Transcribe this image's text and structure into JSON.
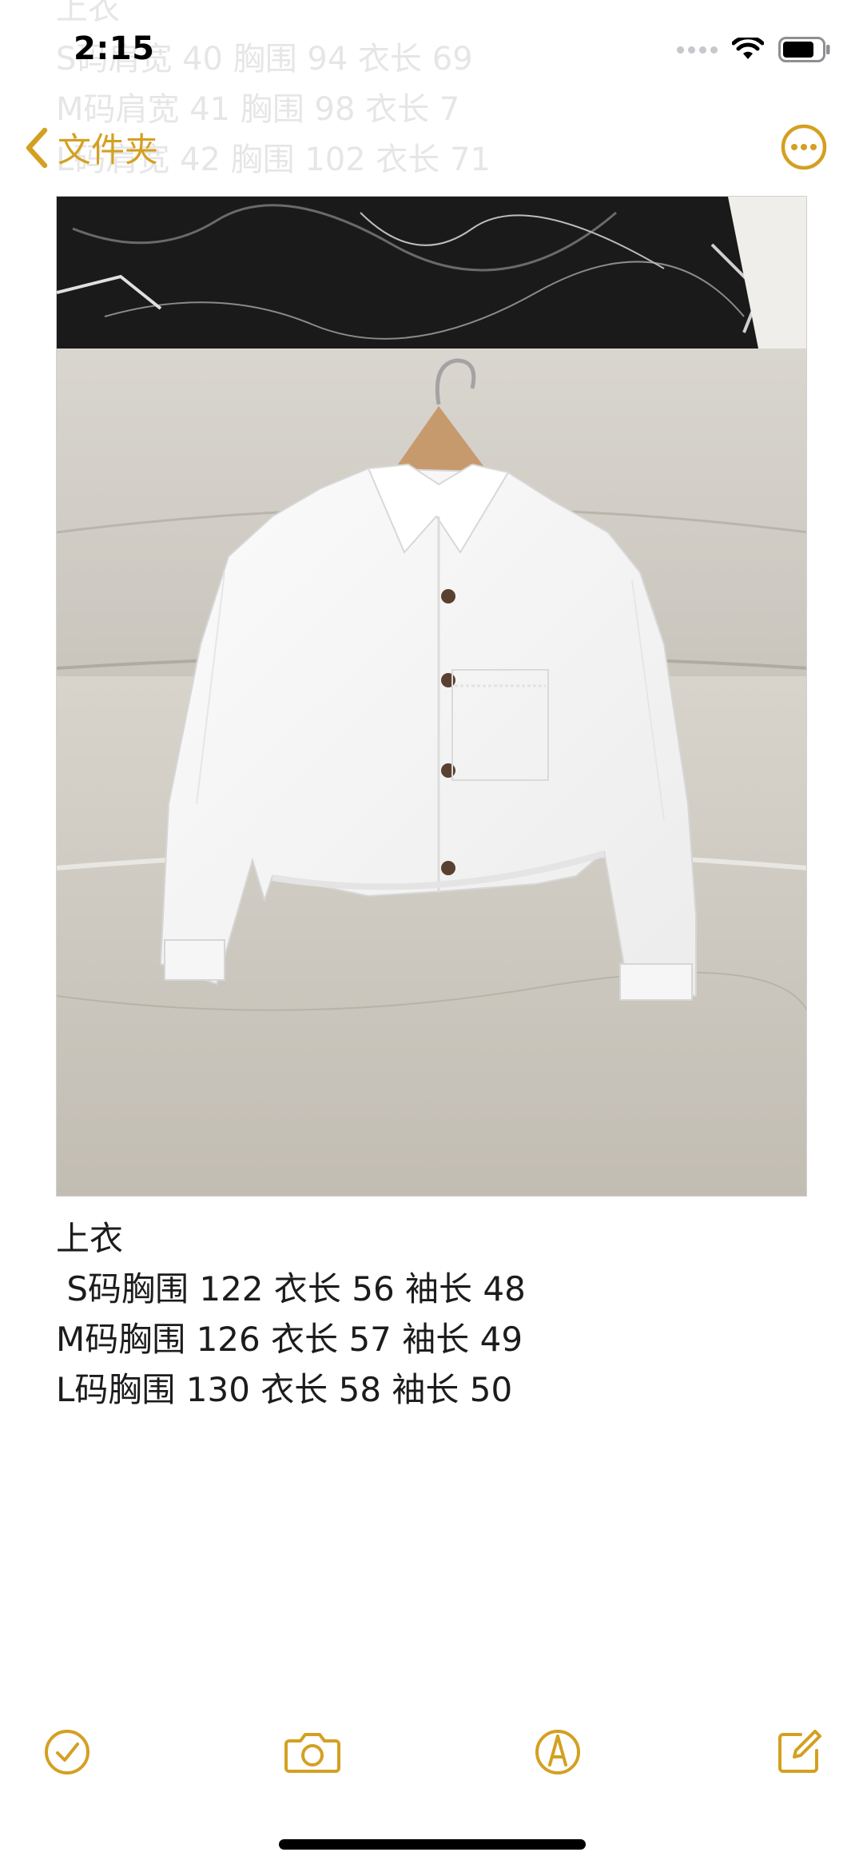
{
  "status_bar": {
    "time": "2:15"
  },
  "nav": {
    "back_label": "文件夹",
    "back_icon": "chevron-left-icon",
    "more_icon": "ellipsis-circle-icon"
  },
  "ghost_lines": [
    "上衣",
    "S码肩宽 40 胸围 94 衣长 69",
    "M码肩宽 41 胸围 98 衣长 7",
    "L码肩宽 42 胸围 102 衣长 71"
  ],
  "photo": {
    "subject": "white long-sleeve shirt on hanger"
  },
  "note": {
    "lines": [
      "上衣",
      " S码胸围 122 衣长 56 袖长 48",
      "M码胸围 126 衣长 57 袖长 49",
      "L码胸围 130 衣长 58 袖长 50"
    ]
  },
  "toolbar": {
    "items": [
      "checklist-icon",
      "camera-icon",
      "markup-pen-icon",
      "compose-icon"
    ]
  },
  "colors": {
    "accent": "#D4A021",
    "text": "#1C1C1E",
    "ghost_text": "#E6E6E6"
  }
}
